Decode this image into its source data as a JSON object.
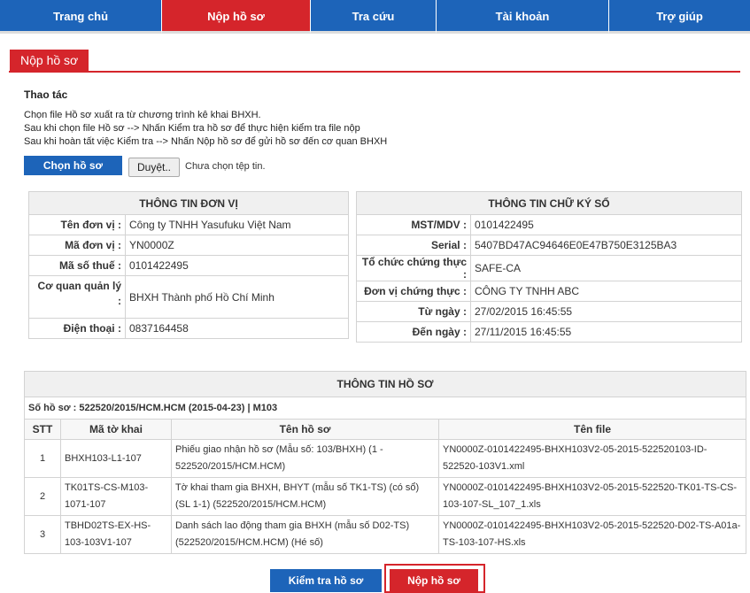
{
  "nav": {
    "items": [
      "Trang chủ",
      "Nộp hồ sơ",
      "Tra cứu",
      "Tài khoản",
      "Trợ giúp"
    ],
    "active": "Nộp hồ sơ"
  },
  "page": {
    "title": "Nộp hồ sơ"
  },
  "ops": {
    "title": "Thao tác",
    "lines": [
      "Chọn file Hồ sơ xuất ra từ chương trình kê khai BHXH.",
      "Sau khi chọn file Hồ sơ --> Nhấn Kiểm tra hồ sơ để thực hiện kiểm tra file nộp",
      "Sau khi hoàn tất việc Kiểm tra --> Nhấn Nộp hồ sơ để gửi hồ sơ đến cơ quan BHXH"
    ],
    "choose_button": "Chọn hồ sơ",
    "browse_button": "Duyệt..",
    "no_file_text": "Chưa chọn tệp tin."
  },
  "unit_info": {
    "title": "THÔNG TIN ĐƠN VỊ",
    "rows": [
      {
        "label": "Tên đơn vị",
        "value": "Công ty TNHH Yasufuku Việt Nam"
      },
      {
        "label": "Mã đơn vị",
        "value": "YN0000Z"
      },
      {
        "label": "Mã số thuế",
        "value": "0101422495"
      },
      {
        "label": "Cơ quan quản lý",
        "value": "BHXH Thành phố Hồ Chí Minh"
      },
      {
        "label": "Điện thoại",
        "value": "0837164458"
      }
    ]
  },
  "sign_info": {
    "title": "THÔNG TIN CHỮ KÝ SỐ",
    "rows": [
      {
        "label": "MST/MDV",
        "value": "0101422495"
      },
      {
        "label": "Serial",
        "value": "5407BD47AC94646E0E47B750E3125BA3"
      },
      {
        "label": "Tổ chức chứng thực",
        "value": "SAFE-CA"
      },
      {
        "label": "Đơn vị chứng thực",
        "value": "CÔNG TY TNHH ABC"
      },
      {
        "label": "Từ ngày",
        "value": "27/02/2015 16:45:55"
      },
      {
        "label": "Đến ngày",
        "value": "27/11/2015 16:45:55"
      }
    ]
  },
  "file_info": {
    "title": "THÔNG TIN HỒ SƠ",
    "subtitle": "Số hồ sơ : 522520/2015/HCM.HCM (2015-04-23) | M103",
    "columns": [
      "STT",
      "Mã tờ khai",
      "Tên hồ sơ",
      "Tên file"
    ],
    "rows": [
      {
        "stt": "1",
        "code": "BHXH103-L1-107",
        "name": "Phiếu giao nhận hồ sơ (Mẫu số: 103/BHXH) (1 - 522520/2015/HCM.HCM)",
        "file": "YN0000Z-0101422495-BHXH103V2-05-2015-522520103-ID-522520-103V1.xml"
      },
      {
        "stt": "2",
        "code": "TK01TS-CS-M103-1071-107",
        "name": "Tờ khai tham gia BHXH, BHYT (mẫu số TK1-TS) (có sổ) (SL 1-1) (522520/2015/HCM.HCM)",
        "file": "YN0000Z-0101422495-BHXH103V2-05-2015-522520-TK01-TS-CS-103-107-SL_107_1.xls"
      },
      {
        "stt": "3",
        "code": "TBHD02TS-EX-HS-103-103V1-107",
        "name": "Danh sách lao động tham gia BHXH (mẫu số D02-TS) (522520/2015/HCM.HCM) (Hé số)",
        "file": "YN0000Z-0101422495-BHXH103V2-05-2015-522520-D02-TS-A01a-TS-103-107-HS.xls"
      }
    ]
  },
  "actions": {
    "check_button": "Kiểm tra hồ sơ",
    "submit_button": "Nộp hồ sơ"
  },
  "colors": {
    "nav_blue": "#1d64b9",
    "accent_red": "#d5252b"
  }
}
